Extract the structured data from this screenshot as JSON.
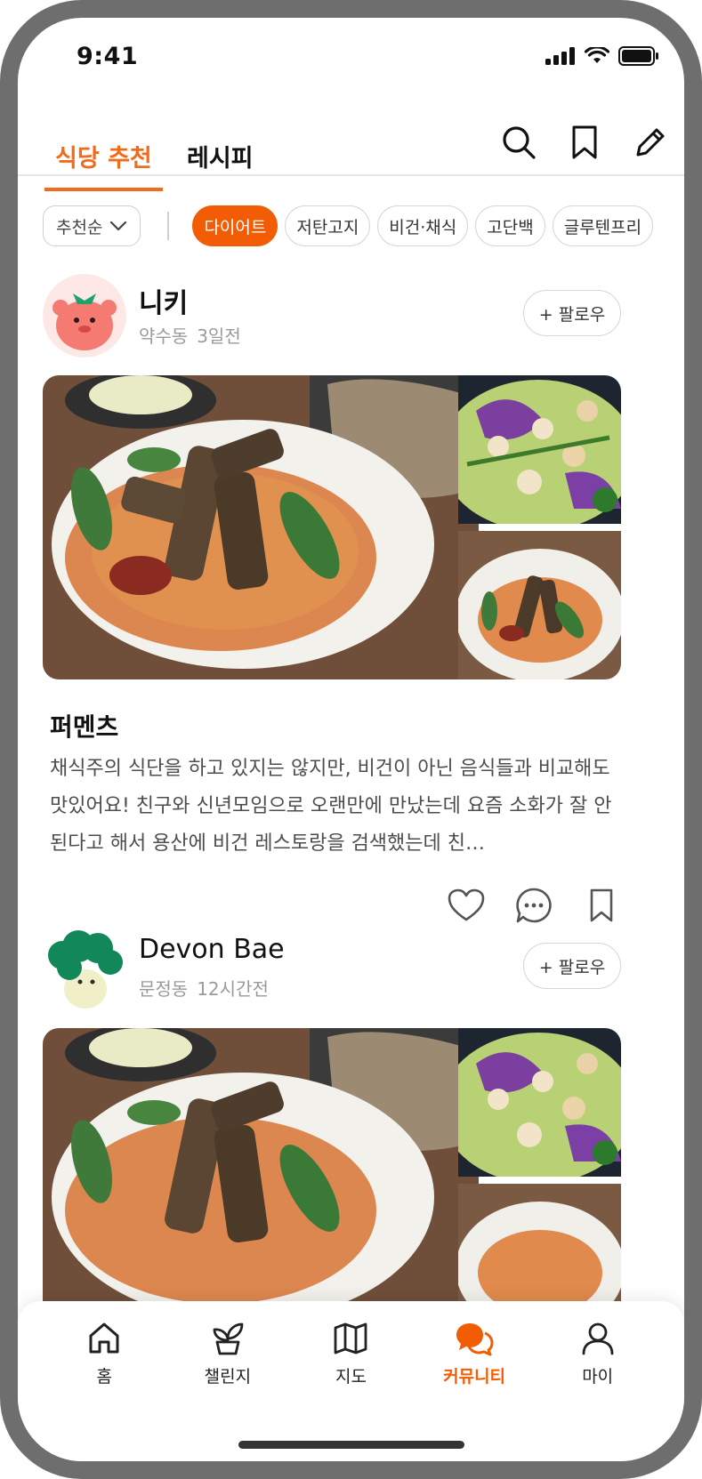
{
  "status_bar": {
    "time": "9:41"
  },
  "tabs": [
    {
      "label": "식당 추천",
      "active": true
    },
    {
      "label": "레시피",
      "active": false
    }
  ],
  "header_icons": [
    "search-icon",
    "bookmark-icon",
    "pencil-icon"
  ],
  "filters": {
    "sort_label": "추천순",
    "chips": [
      {
        "label": "다이어트",
        "active": true
      },
      {
        "label": "저탄고지",
        "active": false
      },
      {
        "label": "비건·채식",
        "active": false
      },
      {
        "label": "고단백",
        "active": false
      },
      {
        "label": "글루텐프리",
        "active": false
      }
    ]
  },
  "posts": [
    {
      "author": "니키",
      "location": "약수동",
      "time_ago": "3일전",
      "follow_label": "+ 팔로우",
      "title": "퍼멘츠",
      "body": "채식주의 식단을 하고 있지는 않지만, 비건이 아닌 음식들과 비교해도 맛있어요! 친구와 신년모임으로 오랜만에 만났는데 요즘 소화가 잘 안된다고 해서 용산에 비건 레스토랑을 검색했는데 친…"
    },
    {
      "author": "Devon Bae",
      "location": "문정동",
      "time_ago": "12시간전",
      "follow_label": "+ 팔로우"
    }
  ],
  "bottom_nav": [
    {
      "label": "홈",
      "icon": "home-icon",
      "active": false
    },
    {
      "label": "챌린지",
      "icon": "sprout-icon",
      "active": false
    },
    {
      "label": "지도",
      "icon": "map-icon",
      "active": false
    },
    {
      "label": "커뮤니티",
      "icon": "chat-bubbles-icon",
      "active": true
    },
    {
      "label": "마이",
      "icon": "user-icon",
      "active": false
    }
  ],
  "colors": {
    "accent": "#F25C05",
    "text": "#111111",
    "muted": "#9A9A9A"
  }
}
